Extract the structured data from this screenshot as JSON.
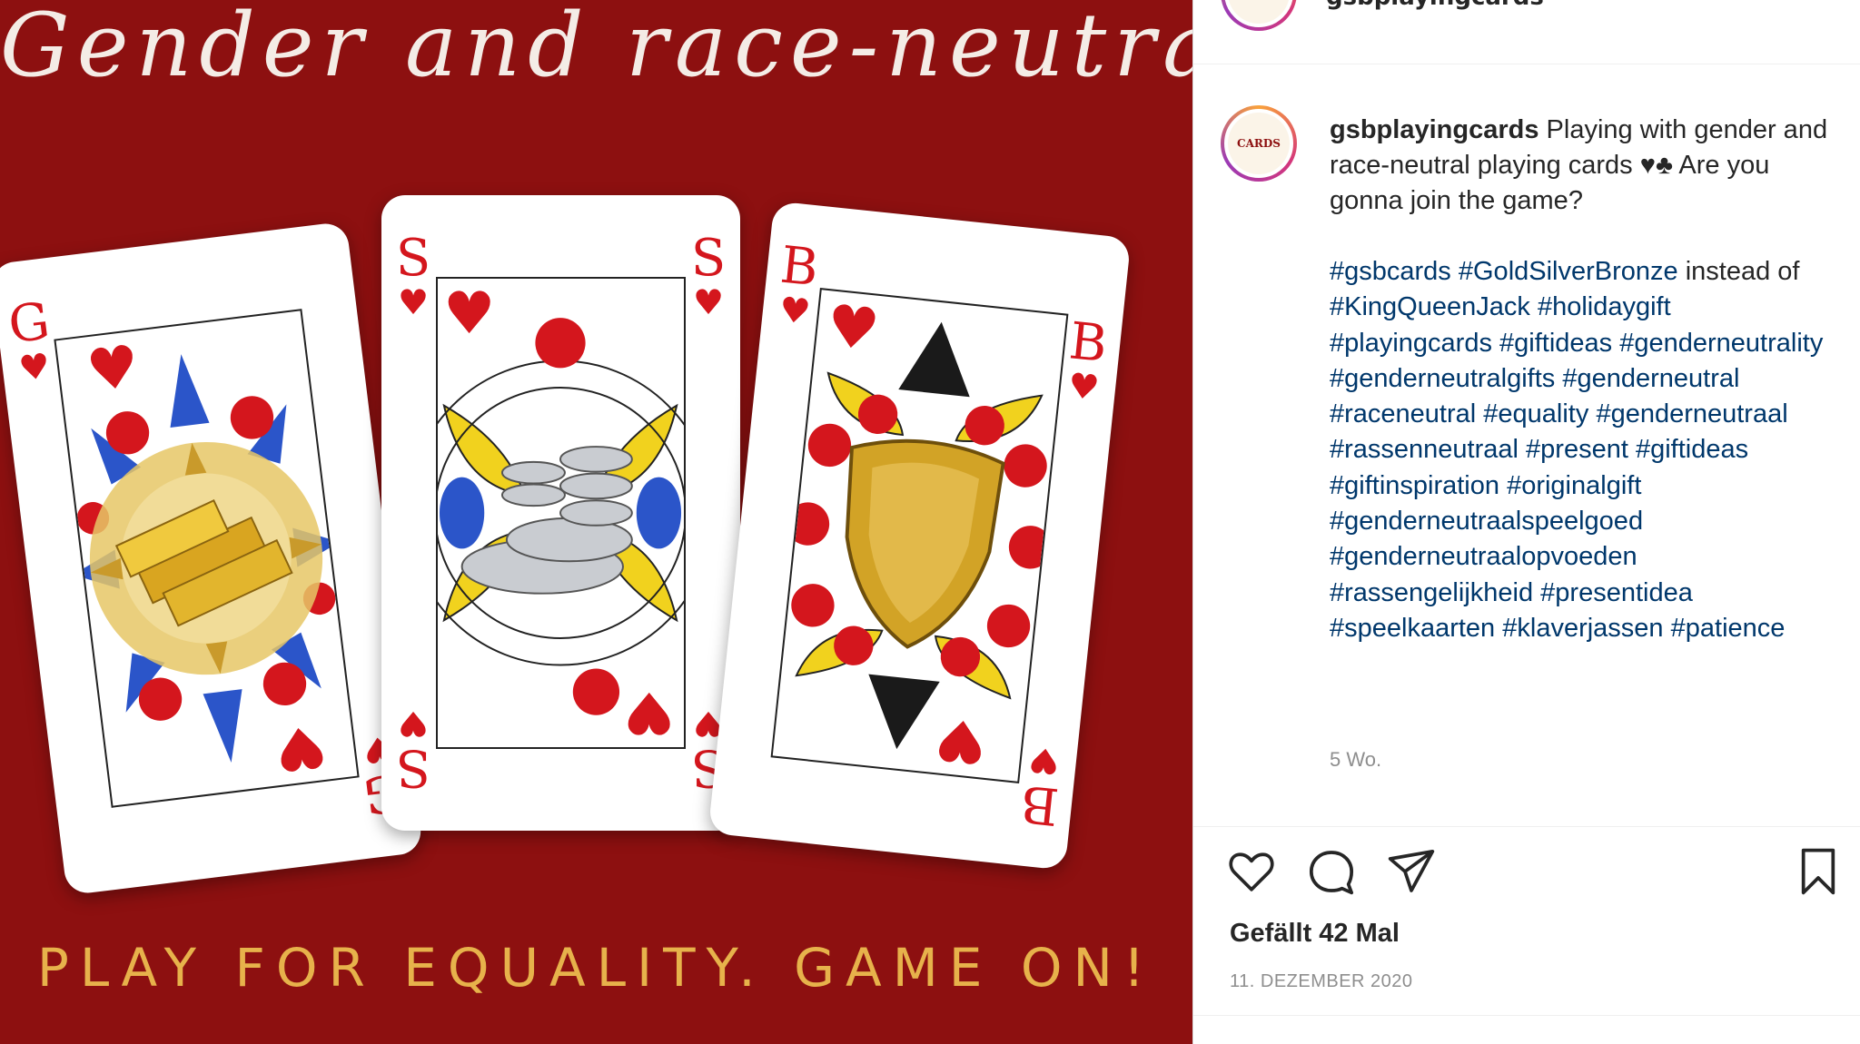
{
  "image": {
    "headline": "Gender and race-neutral",
    "slogan": "PLAY FOR EQUALITY. GAME ON!",
    "cards": [
      {
        "rank": "G",
        "suit": "♥"
      },
      {
        "rank": "S",
        "suit": "♥"
      },
      {
        "rank": "B",
        "suit": "♥"
      }
    ],
    "colors": {
      "background": "#8d1010",
      "slogan": "#e7b24b",
      "suit": "#d4161d"
    }
  },
  "header": {
    "username": "gsbplayingcards",
    "avatar_logo_text": "CARDS"
  },
  "caption": {
    "username": "gsbplayingcards",
    "text": "Playing with gender and race-neutral playing cards ♥♣ Are you gonna join the game?",
    "tags_line1_a": "#gsbcards",
    "tags_line1_b": "#GoldSilverBronze",
    "tags_plain1": "instead of",
    "tags_line2_a": "#KingQueenJack",
    "tags_line2_b": "#holidaygift",
    "tags_rest": [
      "#playingcards",
      "#giftideas",
      "#genderneutrality",
      "#genderneutralgifts",
      "#genderneutral",
      "#raceneutral",
      "#equality",
      "#genderneutraal",
      "#rassenneutraal",
      "#present",
      "#giftideas",
      "#giftinspiration",
      "#originalgift",
      "#genderneutraalspeelgoed",
      "#genderneutraalopvoeden",
      "#rassengelijkheid",
      "#presentidea",
      "#speelkaarten",
      "#klaverjassen",
      "#patience"
    ],
    "age": "5 Wo."
  },
  "actions": {
    "like_icon": "heart-icon",
    "comment_icon": "comment-bubble-icon",
    "share_icon": "paper-plane-icon",
    "save_icon": "bookmark-icon"
  },
  "likes": "Gefällt 42 Mal",
  "date": "11. DEZEMBER 2020"
}
